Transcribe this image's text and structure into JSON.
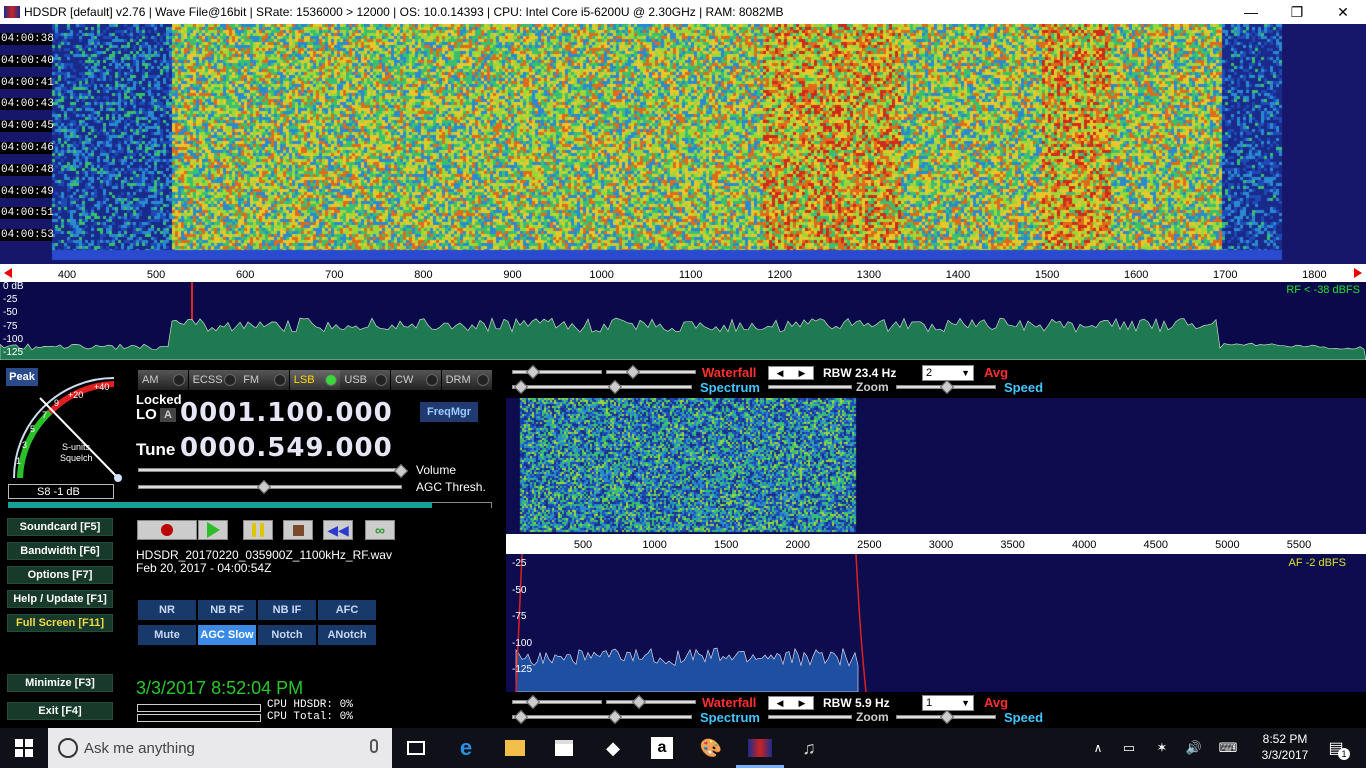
{
  "titlebar": {
    "title": "HDSDR  [default]  v2.76   | Wave File@16bit  | SRate: 1536000 > 12000  | OS: 10.0.14393    | CPU: Intel Core i5-6200U @ 2.30GHz  | RAM: 8082MB",
    "minimize": "—",
    "restore": "❐",
    "close": "✕"
  },
  "waterfall": {
    "time_labels": [
      "04:00:38",
      "04:00:40",
      "04:00:41",
      "04:00:43",
      "04:00:45",
      "04:00:46",
      "04:00:48",
      "04:00:49",
      "04:00:51",
      "04:00:53"
    ]
  },
  "rf_axis": {
    "ticks": [
      "400",
      "500",
      "600",
      "700",
      "800",
      "900",
      "1000",
      "1100",
      "1200",
      "1300",
      "1400",
      "1500",
      "1600",
      "1700",
      "1800"
    ]
  },
  "rf_spectrum": {
    "db_labels": [
      "0 dB",
      "-25",
      "-50",
      "-75",
      "-100",
      "-125"
    ],
    "level_text": "RF < -38 dBFS"
  },
  "smeter": {
    "peak": "Peak",
    "scale": [
      "1",
      "3",
      "5",
      "7",
      "9",
      "+20",
      "+40"
    ],
    "caption1": "S-units",
    "caption2": "Squelch",
    "value": "S8 -1 dB"
  },
  "modes": [
    {
      "label": "AM",
      "active": false
    },
    {
      "label": "ECSS",
      "active": false
    },
    {
      "label": "FM",
      "active": false
    },
    {
      "label": "LSB",
      "active": true
    },
    {
      "label": "USB",
      "active": false
    },
    {
      "label": "CW",
      "active": false
    },
    {
      "label": "DRM",
      "active": false
    }
  ],
  "lo": {
    "locked": "Locked",
    "label": "LO",
    "badge": "A",
    "value": "0001.100.000"
  },
  "tune": {
    "label": "Tune",
    "value": "0000.549.000"
  },
  "freqmgr": "FreqMgr",
  "sliders": {
    "volume": "Volume",
    "agc": "AGC Thresh.",
    "volume_level": 1.0,
    "agc_level": 0.48
  },
  "menu": {
    "soundcard": "Soundcard  [F5]",
    "bandwidth": "Bandwidth  [F6]",
    "options": "Options  [F7]",
    "help": "Help / Update  [F1]",
    "fullscreen": "Full Screen  [F11]",
    "minimize": "Minimize  [F3]",
    "exit": "Exit  [F4]"
  },
  "file": {
    "name": "HDSDR_20170220_035900Z_1100kHz_RF.wav",
    "date": "Feb 20, 2017 - 04:00:54Z"
  },
  "dsp": {
    "nr": "NR",
    "nbrf": "NB RF",
    "nbif": "NB IF",
    "afc": "AFC",
    "mute": "Mute",
    "agc": "AGC Slow",
    "notch": "Notch",
    "anotch": "ANotch"
  },
  "clock": "3/3/2017 8:52:04 PM",
  "cpu": {
    "hdsdr": "CPU HDSDR: 0%",
    "total": "CPU Total: 0%"
  },
  "af_top": {
    "waterfall": "Waterfall",
    "spectrum": "Spectrum",
    "rbw": "RBW 23.4 Hz",
    "avg_value": "2",
    "avg": "Avg",
    "zoom": "Zoom",
    "speed": "Speed"
  },
  "af_axis": {
    "ticks": [
      "500",
      "1000",
      "1500",
      "2000",
      "2500",
      "3000",
      "3500",
      "4000",
      "4500",
      "5000",
      "5500"
    ]
  },
  "af_spectrum": {
    "db_labels": [
      "-25",
      "-50",
      "-75",
      "-100",
      "-125"
    ],
    "level_text": "AF  -2 dBFS"
  },
  "af_bottom": {
    "waterfall": "Waterfall",
    "spectrum": "Spectrum",
    "rbw": "RBW  5.9 Hz",
    "avg_value": "1",
    "avg": "Avg",
    "zoom": "Zoom",
    "speed": "Speed"
  },
  "taskbar": {
    "search_placeholder": "Ask me anything",
    "time": "8:52 PM",
    "date": "3/3/2017",
    "notif_count": "1"
  }
}
